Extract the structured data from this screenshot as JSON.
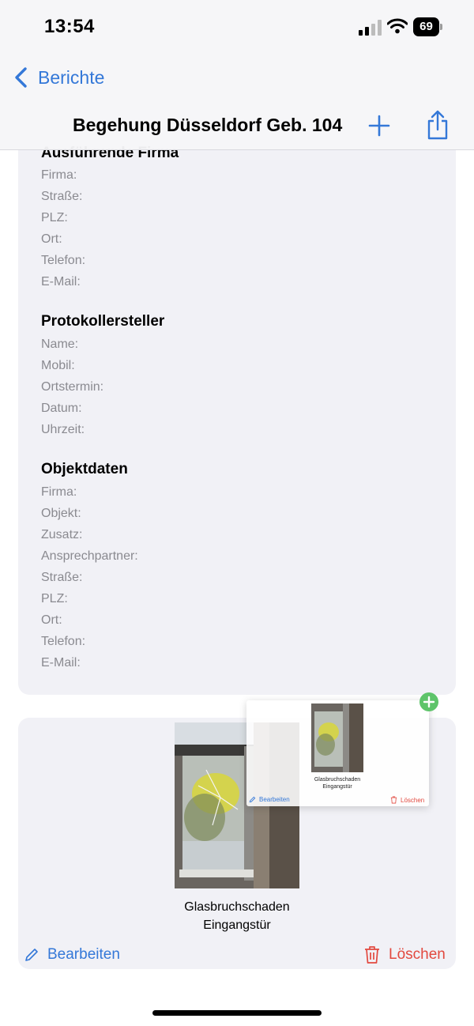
{
  "status_bar": {
    "time": "13:54",
    "battery": "69"
  },
  "nav": {
    "back_label": "Berichte",
    "title": "Begehung Düsseldorf Geb. 104"
  },
  "sections": {
    "firma": {
      "title": "Ausführende Firma",
      "fields": [
        "Firma:",
        "Straße:",
        "PLZ:",
        "Ort:",
        "Telefon:",
        "E-Mail:"
      ]
    },
    "protokoll": {
      "title": "Protokollersteller",
      "fields": [
        "Name:",
        "Mobil:",
        "Ortstermin:",
        "Datum:",
        "Uhrzeit:"
      ]
    },
    "objekt": {
      "title": "Objektdaten",
      "fields": [
        "Firma:",
        "Objekt:",
        "Zusatz:",
        "Ansprechpartner:",
        "Straße:",
        "PLZ:",
        "Ort:",
        "Telefon:",
        "E-Mail:"
      ]
    }
  },
  "photo_card": {
    "caption_line1": "Glasbruchschaden",
    "caption_line2": "Eingangstür",
    "edit_label": "Bearbeiten",
    "delete_label": "Löschen"
  },
  "drag_preview": {
    "caption_line1": "Glasbruchschaden",
    "caption_line2": "Eingangstür",
    "edit_label": "Bearbeiten",
    "delete_label": "Löschen"
  },
  "colors": {
    "accent": "#3478d8",
    "destructive": "#e2493f",
    "add_badge": "#5ec46a",
    "card": "#f1f1f6"
  },
  "icons": [
    "back-chevron-icon",
    "plus-icon",
    "share-icon",
    "pencil-icon",
    "trash-icon",
    "add-circle-icon"
  ]
}
